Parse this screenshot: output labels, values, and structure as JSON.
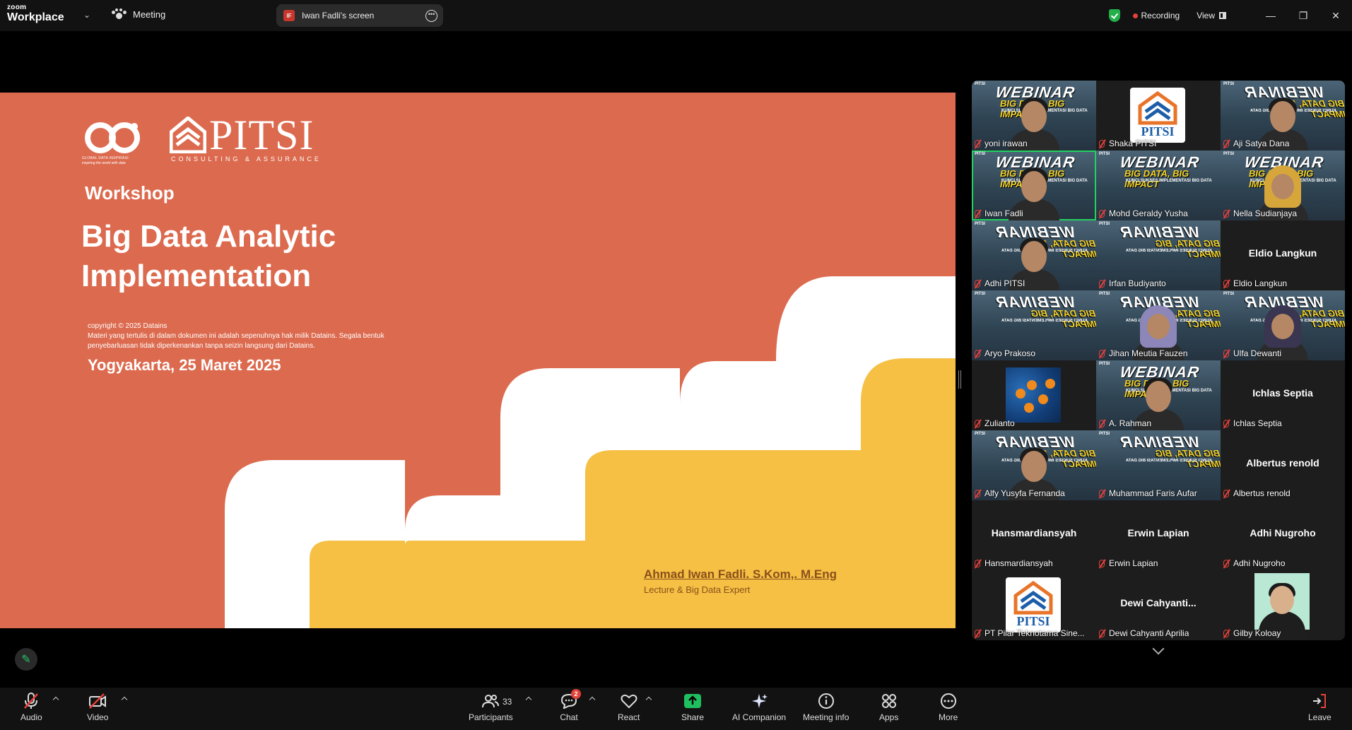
{
  "topbar": {
    "brand_line1": "zoom",
    "brand_line2": "Workplace",
    "meeting_label": "Meeting",
    "share_initials": "IF",
    "share_label": "Iwan Fadli's screen",
    "recording_label": "Recording",
    "view_label": "View"
  },
  "slide": {
    "gdi_caption": "GLOBAL DATA INSPIRASI",
    "gdi_tagline": "inspiring the world with data",
    "pitsi_word": "PITSI",
    "pitsi_sub": "CONSULTING & ASSURANCE",
    "workshop": "Workshop",
    "title_line1": "Big Data Analytic",
    "title_line2": "Implementation",
    "copyright_line1": "copyright © 2025 Datains",
    "copyright_line2": "Materi yang tertulis di dalam dokumen ini adalah sepenuhnya hak milik Datains. Segala bentuk",
    "copyright_line3": "penyebarluasan tidak diperkenankan tanpa seizin langsung dari Datains.",
    "place_date": "Yogyakarta, 25 Maret 2025",
    "author": "Ahmad Iwan Fadli. S.Kom,. M.Eng",
    "role": "Lecture & Big Data Expert"
  },
  "poster": {
    "tag": "PITSI",
    "title": "WEBINAR",
    "subtitle": "BIG DATA, BIG IMPACT",
    "tagline": "KUNCI SUKSES IMPLEMENTASI BIG DATA"
  },
  "gallery": {
    "pitsi_logo_text": "PITSI",
    "participants": [
      {
        "name": "yoni irawan"
      },
      {
        "name": "Shaka PITSI"
      },
      {
        "name": "Aji Satya Dana"
      },
      {
        "name": "Iwan Fadli"
      },
      {
        "name": "Mohd Geraldy Yusha"
      },
      {
        "name": "Nella Sudianjaya"
      },
      {
        "name": "Adhi PITSI"
      },
      {
        "name": "Irfan Budiyanto"
      },
      {
        "name": "Eldio Langkun",
        "display": "Eldio Langkun"
      },
      {
        "name": "Aryo Prakoso"
      },
      {
        "name": "Jihan Meutia Fauzen"
      },
      {
        "name": "Ulfa Dewanti"
      },
      {
        "name": "Zulianto"
      },
      {
        "name": "A. Rahman"
      },
      {
        "name": "Ichlas Septia",
        "display": "Ichlas Septia"
      },
      {
        "name": "Alfy Yusyfa Fernanda"
      },
      {
        "name": "Muhammad Faris Aufar"
      },
      {
        "name": "Albertus renold",
        "display": "Albertus renold"
      },
      {
        "name": "Hansmardiansyah",
        "display": "Hansmardiansyah"
      },
      {
        "name": "Erwin Lapian",
        "display": "Erwin Lapian"
      },
      {
        "name": "Adhi Nugroho",
        "display": "Adhi Nugroho"
      },
      {
        "name": "PT Pilar Teknotama Sine..."
      },
      {
        "name": "Dewi Cahyanti Aprilia",
        "display": "Dewi  Cahyanti..."
      },
      {
        "name": "Gilby Koloay"
      }
    ]
  },
  "toolbar": {
    "audio": "Audio",
    "video": "Video",
    "participants": "Participants",
    "participants_count": "33",
    "chat": "Chat",
    "chat_badge": "2",
    "react": "React",
    "share": "Share",
    "ai_companion": "AI Companion",
    "meeting_info": "Meeting info",
    "apps": "Apps",
    "more": "More",
    "leave": "Leave"
  },
  "colors": {
    "slide_bg": "#dc6a4e",
    "slide_yellow": "#f5c043",
    "active_speaker": "#23d160",
    "muted": "#e5413b",
    "share_green": "#1fbf5f"
  }
}
